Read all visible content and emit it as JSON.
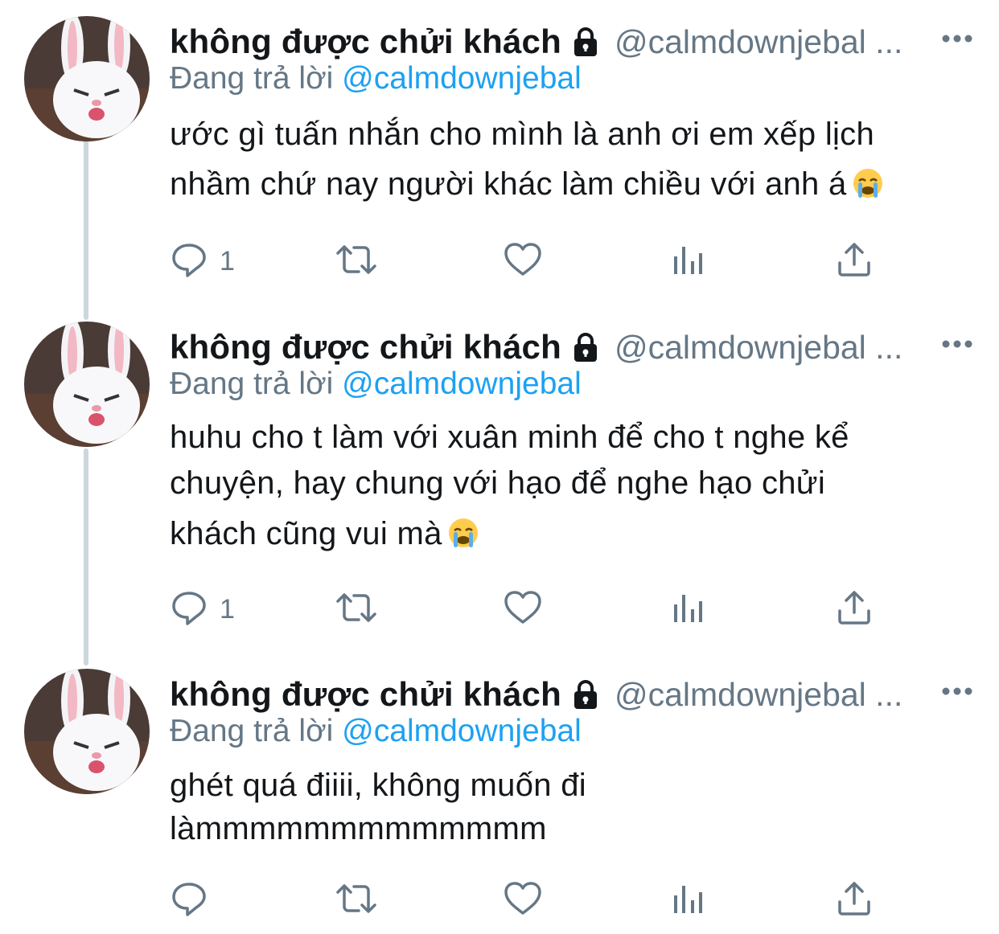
{
  "tweets": [
    {
      "name": "không được chửi khách",
      "handle": "@calmdownjebal ...",
      "reply_prefix": "Đang trả lời",
      "reply_mention": "@calmdownjebal",
      "text_lines": [
        "ước gì tuấn nhắn cho mình là anh ơi em xếp lịch",
        "nhầm chứ nay người khác làm chiều với anh á"
      ],
      "text_emoji": "loudly-crying-face",
      "reply_count": "1"
    },
    {
      "name": "không được chửi khách",
      "handle": "@calmdownjebal ...",
      "reply_prefix": "Đang trả lời",
      "reply_mention": "@calmdownjebal",
      "text_lines": [
        "huhu cho t làm với xuân minh để cho t nghe kể",
        "chuyện, hay chung với hạo để nghe hạo chửi",
        "khách cũng vui mà"
      ],
      "text_emoji": "loudly-crying-face",
      "reply_count": "1"
    },
    {
      "name": "không được chửi khách",
      "handle": "@calmdownjebal ...",
      "reply_prefix": "Đang trả lời",
      "reply_mention": "@calmdownjebal",
      "text_lines": [
        "ghét quá điiii, không muốn đi",
        "làmmmmmmmmmmmmm"
      ],
      "text_emoji": "",
      "reply_count": ""
    }
  ],
  "icons": {
    "reply": "reply-icon",
    "retweet": "retweet-icon",
    "like": "like-icon",
    "analytics": "analytics-icon",
    "share": "share-icon",
    "more": "more-icon",
    "lock": "lock-icon"
  },
  "colors": {
    "link": "#1da1f2",
    "secondary": "#657786",
    "primary": "#14171a",
    "thread_line": "#ccd6dd"
  }
}
